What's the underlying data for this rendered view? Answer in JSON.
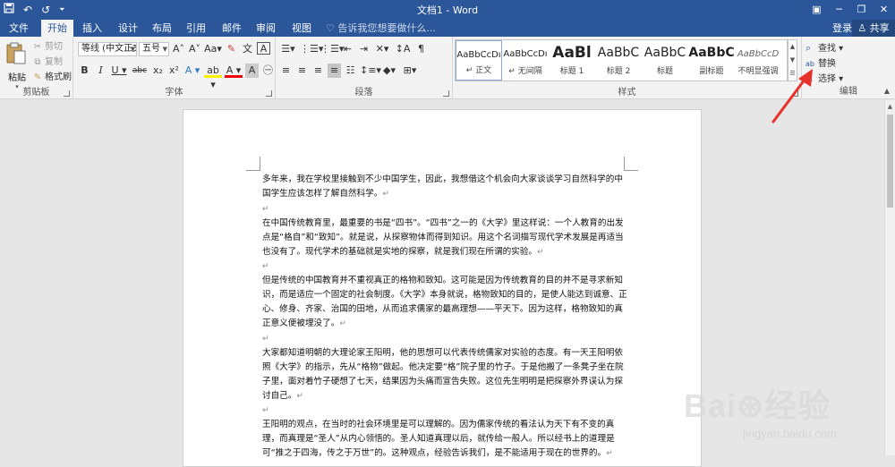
{
  "window": {
    "title": "文档1 - Word",
    "qat": {
      "save_icon": "save-icon",
      "undo_icon": "↶",
      "redo_icon": "↺",
      "more_icon": "⏷"
    },
    "controls": {
      "ribbon_options": "▣",
      "minimize": "─",
      "restore": "❐",
      "close": "✕"
    }
  },
  "tabs": [
    {
      "label": "文件"
    },
    {
      "label": "开始",
      "active": true
    },
    {
      "label": "插入"
    },
    {
      "label": "设计"
    },
    {
      "label": "布局"
    },
    {
      "label": "引用"
    },
    {
      "label": "邮件"
    },
    {
      "label": "审阅"
    },
    {
      "label": "视图"
    }
  ],
  "tell_me": "♡ 告诉我您想要做什么...",
  "account": {
    "login": "登录",
    "share": "♙ 共享"
  },
  "clipboard": {
    "paste": "粘贴",
    "cut": "剪切",
    "copy": "复制",
    "format_painter": "格式刷",
    "label": "剪贴板"
  },
  "font": {
    "name": "等线 (中文正文",
    "size": "五号",
    "grow": "A˄",
    "shrink": "A˅",
    "case": "Aa▾",
    "clear": "✎",
    "phonetic": "文",
    "border": "A",
    "bold": "B",
    "italic": "I",
    "underline": "U ▾",
    "strike": "abc",
    "sub": "x₂",
    "sup": "x²",
    "effects": "A ▾",
    "highlight": "ab ▾",
    "color": "A ▾",
    "shading": "A",
    "enclose": "㊀",
    "label": "字体"
  },
  "paragraph": {
    "bullets": "☰▾",
    "numbering": "⋮☰▾",
    "multilevel": "⋮☰▾",
    "decrease": "⇤",
    "increase": "⇥",
    "chinese_layout": "✕▾",
    "sort": "↕A",
    "show_marks": "¶",
    "align_left": "≡",
    "center": "≡",
    "align_right": "≡",
    "justify": "≡",
    "distributed": "☷",
    "spacing": "↕≡▾",
    "shading": "◆▾",
    "borders": "⊞▾",
    "label": "段落"
  },
  "styles": {
    "items": [
      {
        "sample": "AaBbCcDı",
        "name": "↵ 正文",
        "selected": true
      },
      {
        "sample": "AaBbCcDı",
        "name": "↵ 无间隔"
      },
      {
        "sample": "AaBl",
        "name": "标题 1"
      },
      {
        "sample": "AaBbC",
        "name": "标题 2"
      },
      {
        "sample": "AaBbC",
        "name": "标题"
      },
      {
        "sample": "AaBbC",
        "name": "副标题"
      },
      {
        "sample": "AaBbCcD",
        "name": "不明显强调"
      }
    ],
    "label": "样式"
  },
  "editing": {
    "find": "查找 ▾",
    "replace": "替换",
    "select": "选择 ▾",
    "label": "编辑"
  },
  "document": {
    "paragraphs": [
      "多年来，我在学校里接触到不少中国学生，因此，我想借这个机会向大家谈谈学习自然科学的中国学生应该怎样了解自然科学。",
      "",
      "在中国传统教育里，最重要的书是“四书”。“四书”之一的《大学》里这样说：一个人教育的出发点是“格自”和“致知”。就是说，从探察物体而得到知识。用这个名词描写现代学术发展是再适当也没有了。现代学术的基础就是实地的探察，就是我们现在所谓的实验。",
      "",
      "但是传统的中国教育并不重视真正的格物和致知。这可能是因为传统教育的目的并不是寻求新知识，而是适应一个固定的社会制度。《大学》本身就说，格物致知的目的，是使人能达到诚意、正心、修身、齐家、治国的田地，从而追求儒家的最高理想——平天下。因为这样，格物致知的真正意义便被埋没了。",
      "",
      "大家都知道明朝的大理论家王阳明，他的思想可以代表传统儒家对实验的态度。有一天王阳明依照《大学》的指示，先从“格物”做起。他决定要“格”院子里的竹子。于是他搬了一条凳子坐在院子里，面对着竹子硬想了七天，结果因为头痛而宣告失败。这位先生明明是把探察外界误认为探讨自己。",
      "",
      "王阳明的观点，在当时的社会环境里是可以理解的。因为儒家传统的看法认为天下有不变的真理，而真理是“圣人”从内心领悟的。圣人知道真理以后，就传给一般人。所以经书上的道理是可“推之于四海，传之于万世”的。这种观点，经验告诉我们，是不能适用于现在的世界的。"
    ],
    "para_mark": "↵"
  },
  "watermark": {
    "main": "Bai⊛经验",
    "sub": "jingyan.baidu.com"
  },
  "colors": {
    "accent": "#2b579a",
    "ribbon": "#f3f3f3",
    "canvas": "#e6e6e6",
    "annotation": "#e8312a"
  }
}
